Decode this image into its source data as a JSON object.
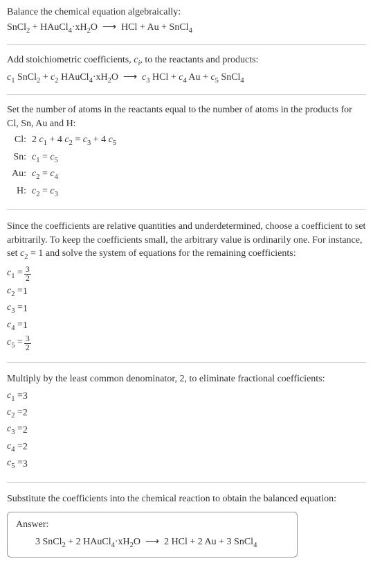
{
  "section1": {
    "intro": "Balance the chemical equation algebraically:",
    "equation_html": "SnCl<sub>2</sub> + HAuCl<sub>4</sub>·xH<sub>2</sub>O &nbsp;⟶&nbsp; HCl + Au + SnCl<sub>4</sub>"
  },
  "section2": {
    "intro_html": "Add stoichiometric coefficients, <span class=\"italic\">c<sub>i</sub></span>, to the reactants and products:",
    "equation_html": "<span class=\"italic\">c</span><sub>1</sub> SnCl<sub>2</sub> + <span class=\"italic\">c</span><sub>2</sub> HAuCl<sub>4</sub>·xH<sub>2</sub>O &nbsp;⟶&nbsp; <span class=\"italic\">c</span><sub>3</sub> HCl + <span class=\"italic\">c</span><sub>4</sub> Au + <span class=\"italic\">c</span><sub>5</sub> SnCl<sub>4</sub>"
  },
  "section3": {
    "intro": "Set the number of atoms in the reactants equal to the number of atoms in the products for Cl, Sn, Au and H:",
    "rows": [
      {
        "label": "Cl:",
        "eq_html": "2 <span class=\"italic\">c</span><sub>1</sub> + 4 <span class=\"italic\">c</span><sub>2</sub> = <span class=\"italic\">c</span><sub>3</sub> + 4 <span class=\"italic\">c</span><sub>5</sub>"
      },
      {
        "label": "Sn:",
        "eq_html": "<span class=\"italic\">c</span><sub>1</sub> = <span class=\"italic\">c</span><sub>5</sub>"
      },
      {
        "label": "Au:",
        "eq_html": "<span class=\"italic\">c</span><sub>2</sub> = <span class=\"italic\">c</span><sub>4</sub>"
      },
      {
        "label": "H:",
        "eq_html": "<span class=\"italic\">c</span><sub>2</sub> = <span class=\"italic\">c</span><sub>3</sub>"
      }
    ]
  },
  "section4": {
    "intro_html": "Since the coefficients are relative quantities and underdetermined, choose a coefficient to set arbitrarily. To keep the coefficients small, the arbitrary value is ordinarily one. For instance, set <span class=\"italic\">c</span><sub>2</sub> = 1 and solve the system of equations for the remaining coefficients:",
    "coefs": [
      {
        "lhs_html": "<span class=\"italic\">c</span><sub>1</sub> = ",
        "rhs_type": "frac",
        "num": "3",
        "den": "2"
      },
      {
        "lhs_html": "<span class=\"italic\">c</span><sub>2</sub> = ",
        "rhs_type": "plain",
        "val": "1"
      },
      {
        "lhs_html": "<span class=\"italic\">c</span><sub>3</sub> = ",
        "rhs_type": "plain",
        "val": "1"
      },
      {
        "lhs_html": "<span class=\"italic\">c</span><sub>4</sub> = ",
        "rhs_type": "plain",
        "val": "1"
      },
      {
        "lhs_html": "<span class=\"italic\">c</span><sub>5</sub> = ",
        "rhs_type": "frac",
        "num": "3",
        "den": "2"
      }
    ]
  },
  "section5": {
    "intro": "Multiply by the least common denominator, 2, to eliminate fractional coefficients:",
    "coefs": [
      {
        "lhs_html": "<span class=\"italic\">c</span><sub>1</sub> = ",
        "val": "3"
      },
      {
        "lhs_html": "<span class=\"italic\">c</span><sub>2</sub> = ",
        "val": "2"
      },
      {
        "lhs_html": "<span class=\"italic\">c</span><sub>3</sub> = ",
        "val": "2"
      },
      {
        "lhs_html": "<span class=\"italic\">c</span><sub>4</sub> = ",
        "val": "2"
      },
      {
        "lhs_html": "<span class=\"italic\">c</span><sub>5</sub> = ",
        "val": "3"
      }
    ]
  },
  "section6": {
    "intro": "Substitute the coefficients into the chemical reaction to obtain the balanced equation:",
    "answer_label": "Answer:",
    "answer_html": "3 SnCl<sub>2</sub> + 2 HAuCl<sub>4</sub>·xH<sub>2</sub>O &nbsp;⟶&nbsp; 2 HCl + 2 Au + 3 SnCl<sub>4</sub>"
  }
}
